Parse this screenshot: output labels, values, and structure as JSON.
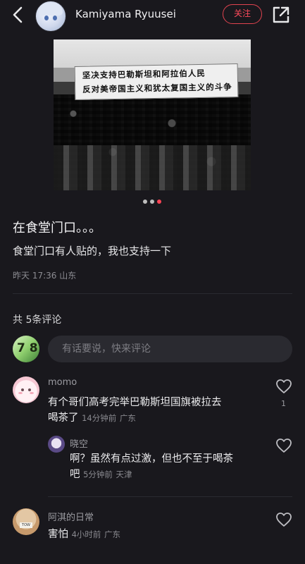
{
  "header": {
    "username": "Kamiyama Ryuusei",
    "follow_label": "关注",
    "icons": {
      "back": "chevron-left-icon",
      "share": "share-external-icon"
    }
  },
  "post": {
    "image": {
      "banner_line1": "坚决支持巴勒斯坦和阿拉伯人民",
      "banner_line2": "反对美帝国主义和犹太复国主义的斗争"
    },
    "carousel": {
      "count": 3,
      "active_index": 2
    },
    "title": "在食堂门口。。。",
    "body": "食堂门口有人贴的，我也支持一下",
    "meta": "昨天 17:36 山东"
  },
  "comments_section": {
    "count_label": "共 5条评论",
    "input_placeholder": "有话要说，快来评论",
    "my_avatar_text": "7 8",
    "comments": [
      {
        "name": "momo",
        "text_line1": "有个哥们高考完举巴勒斯坦国旗被拉去",
        "text_line2": "喝茶了",
        "time": "14分钟前",
        "location": "广东",
        "likes": "1"
      },
      {
        "name": "晓空",
        "text_line1": "啊？虽然有点过激，但也不至于喝茶",
        "text_line2": "吧",
        "time": "5分钟前",
        "location": "天津",
        "reply": true
      },
      {
        "name": "阿淇的日常",
        "text_line1": "害怕",
        "time": "4小时前",
        "location": "广东",
        "avatar_text": "TOW"
      }
    ]
  },
  "colors": {
    "background": "#19181d",
    "accent": "#ff4455",
    "follow_border": "#e0434f"
  }
}
